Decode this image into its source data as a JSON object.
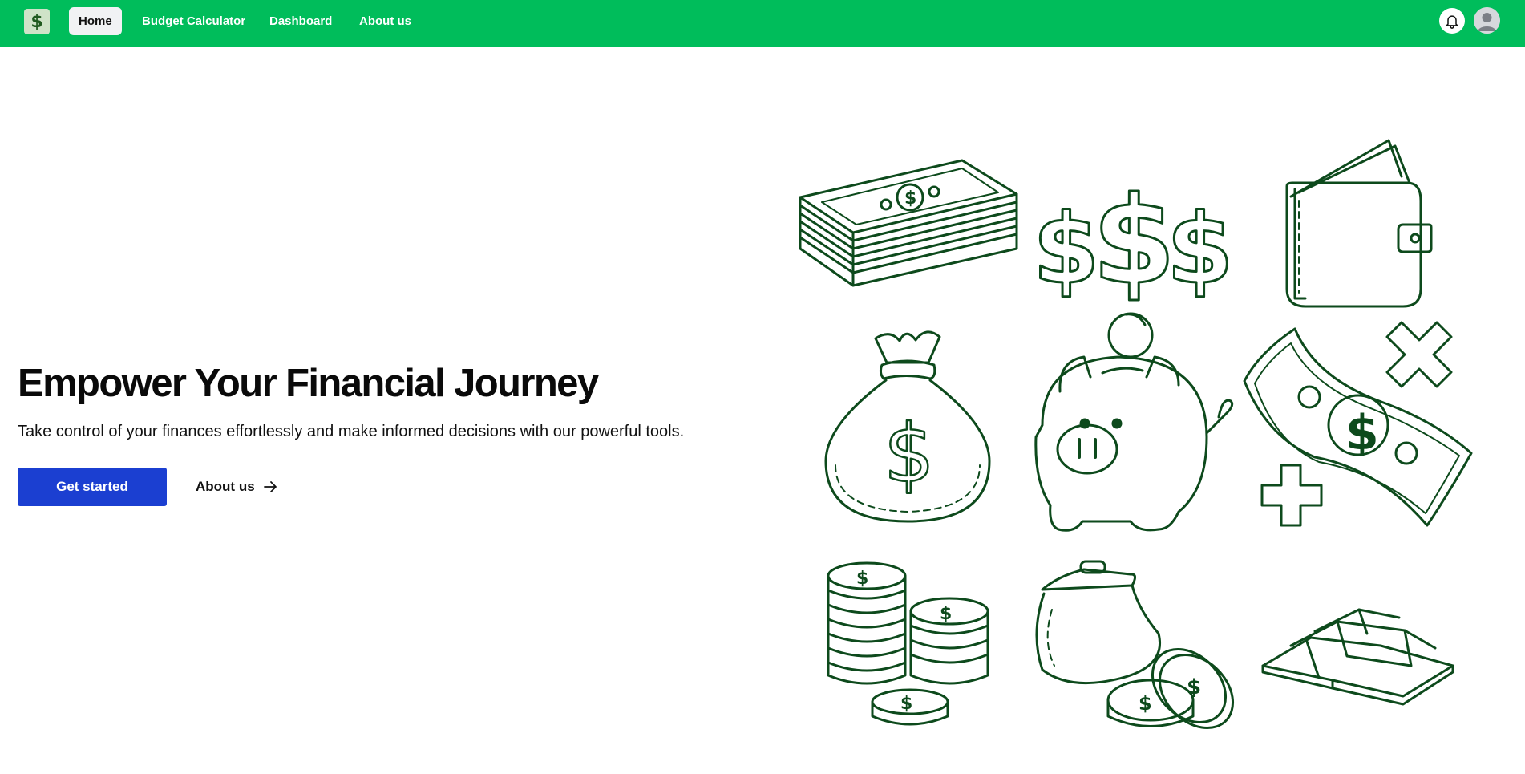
{
  "nav": {
    "logo_symbol": "$",
    "items": [
      {
        "label": "Home",
        "active": true
      },
      {
        "label": "Budget Calculator",
        "active": false
      },
      {
        "label": "Dashboard",
        "active": false
      },
      {
        "label": "About us",
        "active": false
      }
    ],
    "icons": [
      "bell-icon",
      "user-avatar-icon"
    ]
  },
  "hero": {
    "title": "Empower Your Financial Journey",
    "subtitle": "Take control of your finances effortlessly and make informed decisions with our powerful tools.",
    "primary_button": "Get started",
    "secondary_link": "About us"
  },
  "illustration": {
    "items": [
      "cash-stack-icon",
      "dollar-signs-icon",
      "wallet-icon",
      "money-bag-icon",
      "piggy-bank-icon",
      "bill-plus-minus-icon",
      "coin-stacks-icon",
      "coin-purse-icon",
      "gold-bars-icon"
    ],
    "stroke_color": "#0d4a1c"
  },
  "colors": {
    "navbar": "#00bd5b",
    "primary_button": "#1b3fd1",
    "illustration_stroke": "#0d4a1c"
  }
}
